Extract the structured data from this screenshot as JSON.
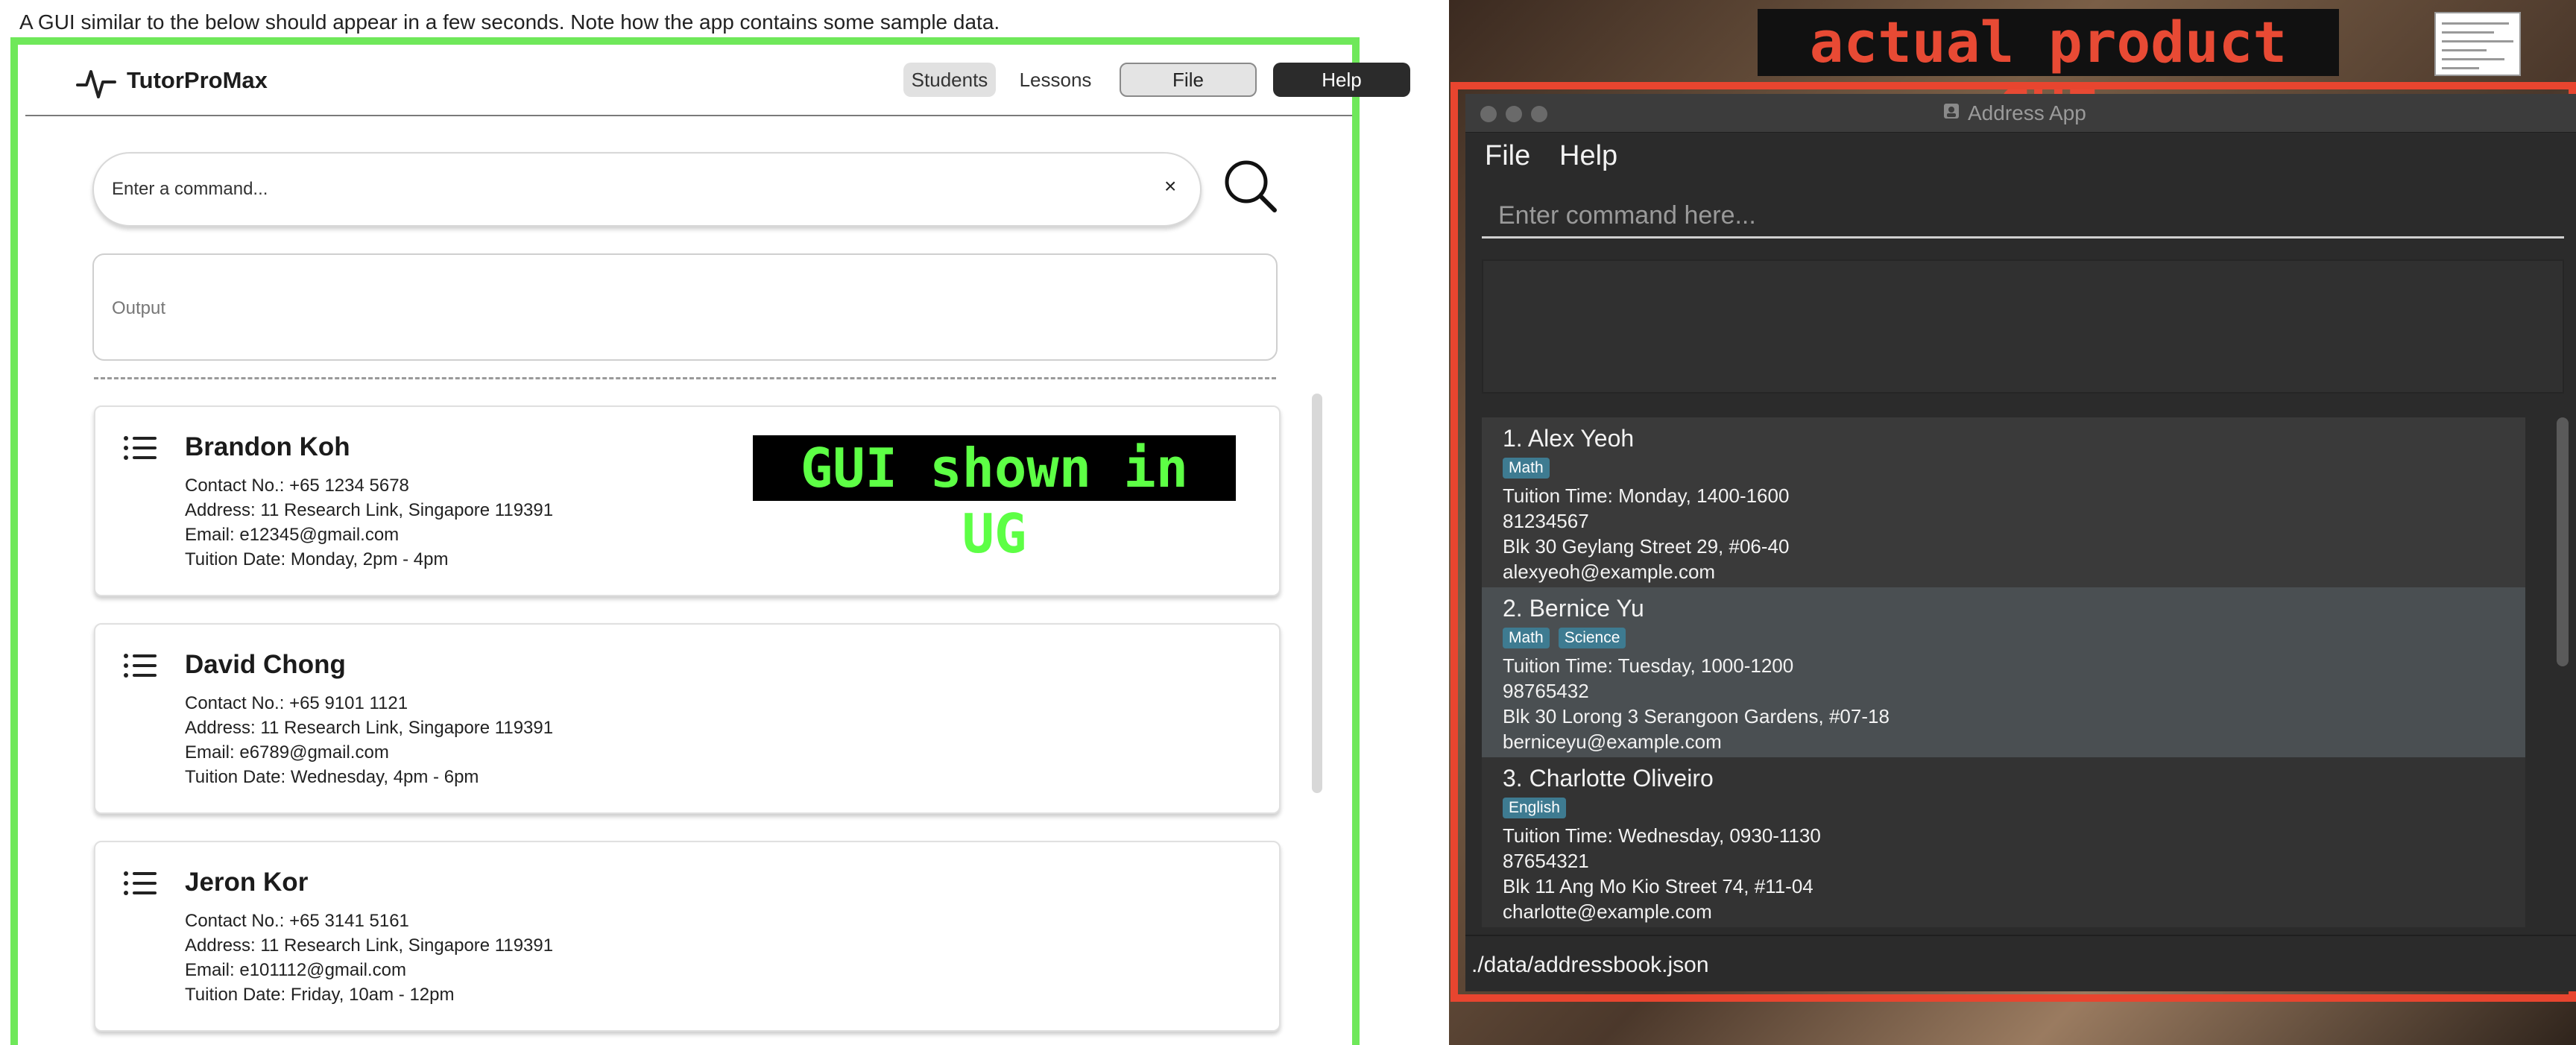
{
  "caption": "A GUI similar to the below should appear in a few seconds. Note how the app contains some sample data.",
  "left_app": {
    "brand": "TutorProMax",
    "nav": {
      "students": "Students",
      "lessons": "Lessons"
    },
    "buttons": {
      "file": "File",
      "help": "Help"
    },
    "command": {
      "placeholder": "Enter a command...",
      "clear": "×"
    },
    "output_label": "Output",
    "overlay_label": "GUI shown in UG",
    "students": [
      {
        "name": "Brandon Koh",
        "contact": "Contact No.: +65 1234 5678",
        "address": "Address: 11 Research Link, Singapore 119391",
        "email": "Email: e12345@gmail.com",
        "tuition": "Tuition Date: Monday, 2pm - 4pm"
      },
      {
        "name": "David Chong",
        "contact": "Contact No.: +65 9101 1121",
        "address": "Address: 11 Research Link, Singapore 119391",
        "email": "Email: e6789@gmail.com",
        "tuition": "Tuition Date: Wednesday, 4pm - 6pm"
      },
      {
        "name": "Jeron Kor",
        "contact": "Contact No.: +65 3141 5161",
        "address": "Address: 11 Research Link, Singapore 119391",
        "email": "Email: e101112@gmail.com",
        "tuition": "Tuition Date: Friday, 10am - 12pm"
      }
    ]
  },
  "right_app": {
    "overlay_label": "actual product GUI",
    "window_title": "Address App",
    "menu": {
      "file": "File",
      "help": "Help"
    },
    "command_placeholder": "Enter command here...",
    "persons": [
      {
        "name": "1. Alex Yeoh",
        "tags": [
          "Math"
        ],
        "tuition": "Tuition Time: Monday, 1400-1600",
        "phone": "81234567",
        "address": "Blk 30 Geylang Street 29, #06-40",
        "email": "alexyeoh@example.com"
      },
      {
        "name": "2. Bernice Yu",
        "tags": [
          "Math",
          "Science"
        ],
        "tuition": "Tuition Time: Tuesday, 1000-1200",
        "phone": "98765432",
        "address": "Blk 30 Lorong 3 Serangoon Gardens, #07-18",
        "email": "berniceyu@example.com"
      },
      {
        "name": "3. Charlotte Oliveiro",
        "tags": [
          "English"
        ],
        "tuition": "Tuition Time: Wednesday, 0930-1130",
        "phone": "87654321",
        "address": "Blk 11 Ang Mo Kio Street 74, #11-04",
        "email": "charlotte@example.com"
      }
    ],
    "status": "./data/addressbook.json",
    "colors": {
      "tag": "#3e7b91",
      "selected_row": "#4a4f52",
      "frame": "#e8452f"
    }
  },
  "colors": {
    "green_frame": "#6fe85a",
    "overlay_green": "#5dff45"
  }
}
